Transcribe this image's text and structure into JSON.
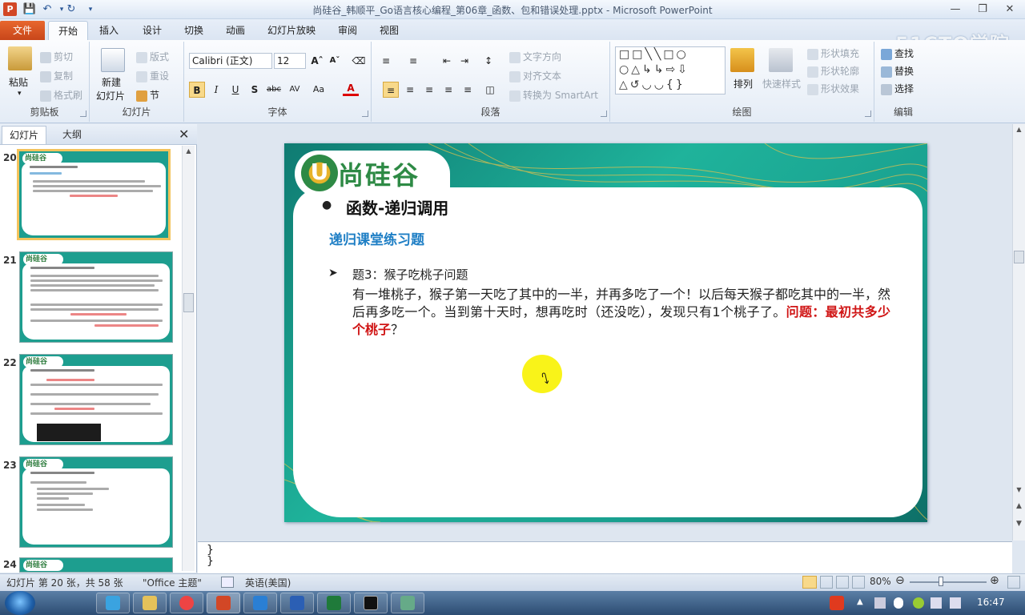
{
  "window": {
    "title": "尚硅谷_韩顺平_Go语言核心编程_第06章_函数、包和错误处理.pptx - Microsoft PowerPoint",
    "app_letter": "P",
    "watermark": "51CTO学院"
  },
  "tabs": [
    "文件",
    "开始",
    "插入",
    "设计",
    "切换",
    "动画",
    "幻灯片放映",
    "审阅",
    "视图"
  ],
  "ribbon": {
    "clipboard": {
      "label": "剪贴板",
      "paste": "粘贴",
      "cut": "剪切",
      "copy": "复制",
      "format_painter": "格式刷"
    },
    "slides": {
      "label": "幻灯片",
      "new_slide": "新建",
      "new_slide2": "幻灯片",
      "layout": "版式",
      "reset": "重设",
      "section": "节"
    },
    "font": {
      "label": "字体",
      "font_name": "Calibri (正文)",
      "font_size": "12"
    },
    "paragraph": {
      "label": "段落",
      "text_direction": "文字方向",
      "align_text": "对齐文本",
      "convert_smartart": "转换为 SmartArt"
    },
    "drawing": {
      "label": "绘图",
      "arrange": "排列",
      "quick_styles": "快速样式",
      "shape_fill": "形状填充",
      "shape_outline": "形状轮廓",
      "shape_effects": "形状效果"
    },
    "editing": {
      "label": "编辑",
      "find": "查找",
      "replace": "替换",
      "select": "选择"
    }
  },
  "panel": {
    "tab_slides": "幻灯片",
    "tab_outline": "大纲",
    "thumb_numbers": [
      "20",
      "21",
      "22",
      "23",
      "24"
    ]
  },
  "slide": {
    "logo_text": "尚硅谷",
    "heading": "函数-递归调用",
    "subheading": "递归课堂练习题",
    "problem_title": "题3：猴子吃桃子问题",
    "problem_body": "有一堆桃子，猴子第一天吃了其中的一半，并再多吃了一个！以后每天猴子都吃其中的一半，然后再多吃一个。当到第十天时，想再吃时（还没吃），发现只有1个桃子了。",
    "problem_question": "问题：最初共多少个桃子",
    "problem_end": "？"
  },
  "notes": {
    "text": "}\n}"
  },
  "status": {
    "slide_info": "幻灯片 第 20 张，共 58 张",
    "theme": "\"Office 主题\"",
    "language": "英语(美国)",
    "zoom": "80%"
  },
  "taskbar": {
    "time": "16:47"
  }
}
